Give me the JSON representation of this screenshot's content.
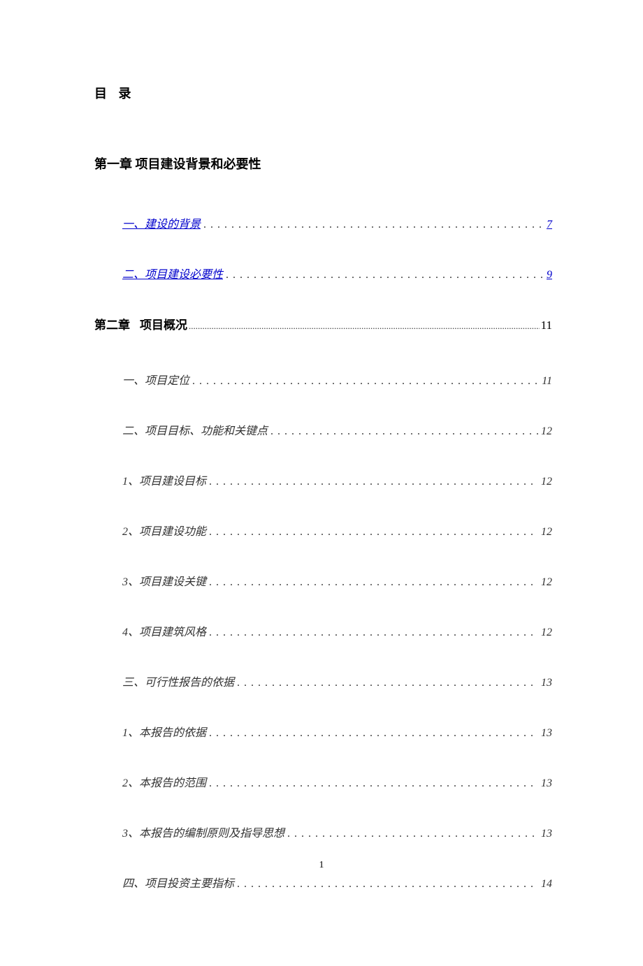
{
  "title": "目 录",
  "chapter1": {
    "heading": "第一章 项目建设背景和必要性",
    "entries": [
      {
        "label": "一、建设的背景",
        "page": "7",
        "link": true
      },
      {
        "label": "二、项目建设必要性",
        "page": "9",
        "link": true
      }
    ]
  },
  "chapter2": {
    "label": "第二章",
    "text": "项目概况",
    "page": "11",
    "entries": [
      {
        "label": "一、项目定位",
        "page": "11"
      },
      {
        "label": "二、项目目标、功能和关键点",
        "page": "12"
      },
      {
        "label": "1、项目建设目标",
        "page": "12"
      },
      {
        "label": "2、项目建设功能",
        "page": "12"
      },
      {
        "label": "3、项目建设关键",
        "page": "12"
      },
      {
        "label": "4、项目建筑风格",
        "page": "12"
      },
      {
        "label": "三、可行性报告的依据",
        "page": "13"
      },
      {
        "label": "1、本报告的依据",
        "page": "13"
      },
      {
        "label": "2、本报告的范围",
        "page": "13"
      },
      {
        "label": "3、本报告的编制原则及指导思想",
        "page": "13"
      },
      {
        "label": "四、项目投资主要指标",
        "page": "14"
      }
    ]
  },
  "pageNumber": "1",
  "dotsCoarse": ". . . . . . . . . . . . . . . . . . . . . . . . . . . . . . . . . . . . . . . . . . . . . . . . . . . . . . . . . . . . . . . . . . . . . . . . . . . . . . . .",
  "dotsFine": ".........................................................................................................................................................................................................."
}
